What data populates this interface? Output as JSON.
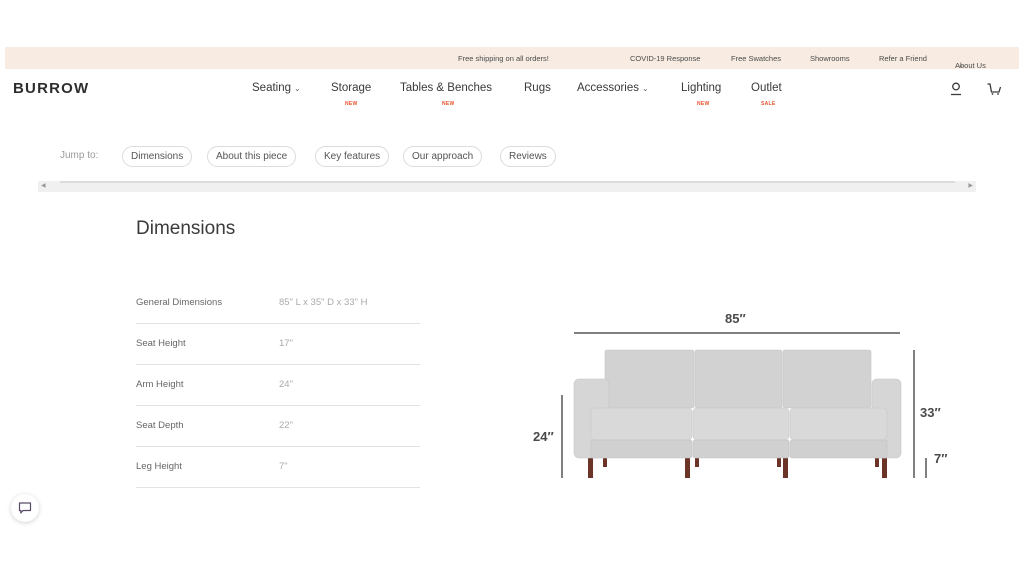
{
  "topbar": {
    "promo": "Free shipping on all orders!",
    "links": [
      "COVID-19 Response",
      "Free Swatches",
      "Showrooms",
      "Refer a Friend",
      "About Us"
    ]
  },
  "header": {
    "logo": "BURROW",
    "nav": [
      {
        "label": "Seating",
        "badge": "",
        "has_dropdown": true
      },
      {
        "label": "Storage",
        "badge": "NEW",
        "has_dropdown": false
      },
      {
        "label": "Tables & Benches",
        "badge": "NEW",
        "has_dropdown": false
      },
      {
        "label": "Rugs",
        "badge": "",
        "has_dropdown": false
      },
      {
        "label": "Accessories",
        "badge": "",
        "has_dropdown": true
      },
      {
        "label": "Lighting",
        "badge": "NEW",
        "has_dropdown": false
      },
      {
        "label": "Outlet",
        "badge": "SALE",
        "has_dropdown": false
      }
    ],
    "icons": [
      "account-icon",
      "cart-icon"
    ],
    "badge_color": "#e8532b"
  },
  "jump": {
    "label": "Jump to:",
    "links": [
      "Dimensions",
      "About this piece",
      "Key features",
      "Our approach",
      "Reviews"
    ]
  },
  "dimensions": {
    "title": "Dimensions",
    "rows": [
      {
        "label": "General Dimensions",
        "value": "85\" L x 35\" D x 33\" H"
      },
      {
        "label": "Seat Height",
        "value": "17\""
      },
      {
        "label": "Arm Height",
        "value": "24\""
      },
      {
        "label": "Seat Depth",
        "value": "22\""
      },
      {
        "label": "Leg Height",
        "value": "7\""
      }
    ],
    "diagram": {
      "width": "85″",
      "height": "33″",
      "arm": "24″",
      "leg": "7″"
    }
  },
  "colors": {
    "topbar_bg": "#f8ece2",
    "sofa_fabric": "#cfcfcf",
    "sofa_legs": "#6b3426"
  }
}
